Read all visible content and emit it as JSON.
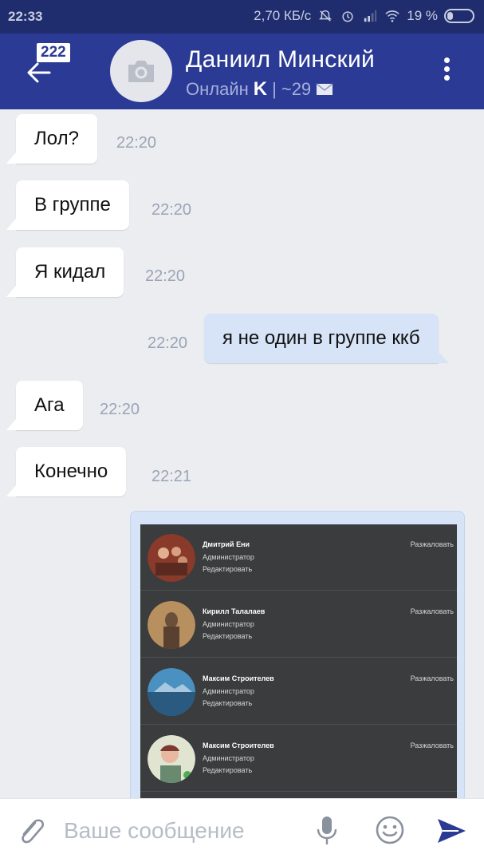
{
  "status_bar": {
    "time": "22:33",
    "network_speed": "2,70 КБ/с",
    "battery": "19 %"
  },
  "header": {
    "unread_count": "222",
    "contact_name": "Даниил Минский",
    "status": "Онлайн",
    "platform_letter": "K",
    "separator": "|",
    "counter": "~29",
    "icons": [
      "back-arrow-icon",
      "camera-icon",
      "envelope-icon",
      "more-vertical-icon"
    ]
  },
  "messages": [
    {
      "direction": "in",
      "text": "Лол?",
      "time": "22:20"
    },
    {
      "direction": "in",
      "text": "В группе",
      "time": "22:20"
    },
    {
      "direction": "in",
      "text": "Я кидал",
      "time": "22:20"
    },
    {
      "direction": "out",
      "text": "я не один в группе ккб",
      "time": "22:20"
    },
    {
      "direction": "in",
      "text": "Ага",
      "time": "22:20"
    },
    {
      "direction": "in",
      "text": "Конечно",
      "time": "22:21"
    }
  ],
  "image_message": {
    "admins": [
      {
        "name": "Дмитрий Ени",
        "role": "Администратор",
        "edit": "Редактировать",
        "demote": "Разжаловать"
      },
      {
        "name": "Кирилл Талалаев",
        "role": "Администратор",
        "edit": "Редактировать",
        "demote": "Разжаловать"
      },
      {
        "name": "Максим Строителев",
        "role": "Администратор",
        "edit": "Редактировать",
        "demote": "Разжаловать"
      },
      {
        "name": "Максим Строителев",
        "role": "Администратор",
        "edit": "Редактировать",
        "demote": "Разжаловать"
      }
    ]
  },
  "composer": {
    "placeholder": "Ваше сообщение",
    "icons": [
      "paperclip-icon",
      "microphone-icon",
      "smiley-icon",
      "send-icon"
    ]
  },
  "colors": {
    "header": "#2b3a94",
    "status_bar": "#1f2d6e",
    "chat_background": "#ebedf0",
    "outgoing_bubble": "#d7e4f7",
    "accent": "#2b3a94"
  }
}
